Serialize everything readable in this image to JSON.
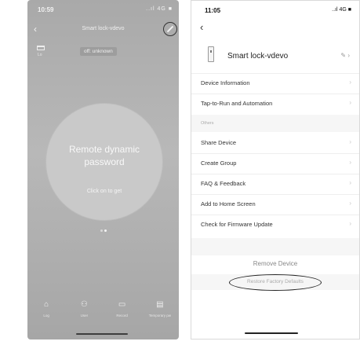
{
  "left": {
    "status": {
      "time": "10:59",
      "icons": "..ıl 4G ■"
    },
    "back_icon": "‹",
    "title": "Smart lock-vdevo",
    "card_sub": "Lo",
    "status_badge": "off: unknown",
    "circle": {
      "title_line1": "Remote dynamic",
      "title_line2": "password",
      "subtitle": "Click on to get"
    },
    "nav": [
      {
        "icon": "⌂",
        "label": "Log"
      },
      {
        "icon": "⚇",
        "label": "User"
      },
      {
        "icon": "▭",
        "label": "Record"
      },
      {
        "icon": "▤",
        "label": "Temporary pw"
      }
    ]
  },
  "right": {
    "status": {
      "time": "11:05",
      "icons": "..ıl 4G ■"
    },
    "back_icon": "‹",
    "device_name": "Smart lock-vdevo",
    "edit_icon": "✎ ›",
    "rows_top": [
      {
        "label": "Device Information",
        "chevron": "›"
      },
      {
        "label": "Tap-to-Run and Automation",
        "chevron": "›"
      }
    ],
    "section_others": "Others",
    "rows_others": [
      {
        "label": "Share Device",
        "chevron": "›"
      },
      {
        "label": "Create Group",
        "chevron": "›"
      },
      {
        "label": "FAQ & Feedback",
        "chevron": "›"
      },
      {
        "label": "Add to Home Screen",
        "chevron": "›"
      },
      {
        "label": "Check for Firmware Update",
        "chevron": "›"
      }
    ],
    "remove_device": "Remove Device",
    "restore_defaults": "Restore Factory Defaults"
  }
}
